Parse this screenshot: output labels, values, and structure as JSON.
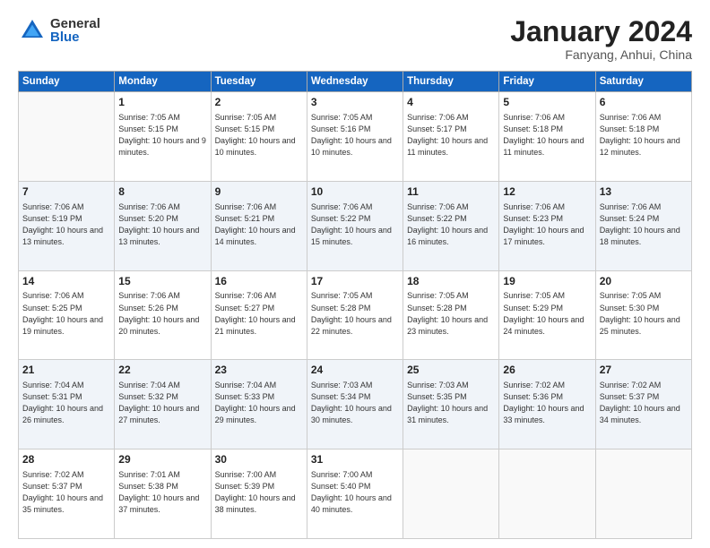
{
  "header": {
    "logo_general": "General",
    "logo_blue": "Blue",
    "month_title": "January 2024",
    "location": "Fanyang, Anhui, China"
  },
  "days_of_week": [
    "Sunday",
    "Monday",
    "Tuesday",
    "Wednesday",
    "Thursday",
    "Friday",
    "Saturday"
  ],
  "weeks": [
    {
      "days": [
        {
          "num": "",
          "info": ""
        },
        {
          "num": "1",
          "info": "Sunrise: 7:05 AM\nSunset: 5:15 PM\nDaylight: 10 hours\nand 9 minutes."
        },
        {
          "num": "2",
          "info": "Sunrise: 7:05 AM\nSunset: 5:15 PM\nDaylight: 10 hours\nand 10 minutes."
        },
        {
          "num": "3",
          "info": "Sunrise: 7:05 AM\nSunset: 5:16 PM\nDaylight: 10 hours\nand 10 minutes."
        },
        {
          "num": "4",
          "info": "Sunrise: 7:06 AM\nSunset: 5:17 PM\nDaylight: 10 hours\nand 11 minutes."
        },
        {
          "num": "5",
          "info": "Sunrise: 7:06 AM\nSunset: 5:18 PM\nDaylight: 10 hours\nand 11 minutes."
        },
        {
          "num": "6",
          "info": "Sunrise: 7:06 AM\nSunset: 5:18 PM\nDaylight: 10 hours\nand 12 minutes."
        }
      ]
    },
    {
      "days": [
        {
          "num": "7",
          "info": "Sunrise: 7:06 AM\nSunset: 5:19 PM\nDaylight: 10 hours\nand 13 minutes."
        },
        {
          "num": "8",
          "info": "Sunrise: 7:06 AM\nSunset: 5:20 PM\nDaylight: 10 hours\nand 13 minutes."
        },
        {
          "num": "9",
          "info": "Sunrise: 7:06 AM\nSunset: 5:21 PM\nDaylight: 10 hours\nand 14 minutes."
        },
        {
          "num": "10",
          "info": "Sunrise: 7:06 AM\nSunset: 5:22 PM\nDaylight: 10 hours\nand 15 minutes."
        },
        {
          "num": "11",
          "info": "Sunrise: 7:06 AM\nSunset: 5:22 PM\nDaylight: 10 hours\nand 16 minutes."
        },
        {
          "num": "12",
          "info": "Sunrise: 7:06 AM\nSunset: 5:23 PM\nDaylight: 10 hours\nand 17 minutes."
        },
        {
          "num": "13",
          "info": "Sunrise: 7:06 AM\nSunset: 5:24 PM\nDaylight: 10 hours\nand 18 minutes."
        }
      ]
    },
    {
      "days": [
        {
          "num": "14",
          "info": "Sunrise: 7:06 AM\nSunset: 5:25 PM\nDaylight: 10 hours\nand 19 minutes."
        },
        {
          "num": "15",
          "info": "Sunrise: 7:06 AM\nSunset: 5:26 PM\nDaylight: 10 hours\nand 20 minutes."
        },
        {
          "num": "16",
          "info": "Sunrise: 7:06 AM\nSunset: 5:27 PM\nDaylight: 10 hours\nand 21 minutes."
        },
        {
          "num": "17",
          "info": "Sunrise: 7:05 AM\nSunset: 5:28 PM\nDaylight: 10 hours\nand 22 minutes."
        },
        {
          "num": "18",
          "info": "Sunrise: 7:05 AM\nSunset: 5:28 PM\nDaylight: 10 hours\nand 23 minutes."
        },
        {
          "num": "19",
          "info": "Sunrise: 7:05 AM\nSunset: 5:29 PM\nDaylight: 10 hours\nand 24 minutes."
        },
        {
          "num": "20",
          "info": "Sunrise: 7:05 AM\nSunset: 5:30 PM\nDaylight: 10 hours\nand 25 minutes."
        }
      ]
    },
    {
      "days": [
        {
          "num": "21",
          "info": "Sunrise: 7:04 AM\nSunset: 5:31 PM\nDaylight: 10 hours\nand 26 minutes."
        },
        {
          "num": "22",
          "info": "Sunrise: 7:04 AM\nSunset: 5:32 PM\nDaylight: 10 hours\nand 27 minutes."
        },
        {
          "num": "23",
          "info": "Sunrise: 7:04 AM\nSunset: 5:33 PM\nDaylight: 10 hours\nand 29 minutes."
        },
        {
          "num": "24",
          "info": "Sunrise: 7:03 AM\nSunset: 5:34 PM\nDaylight: 10 hours\nand 30 minutes."
        },
        {
          "num": "25",
          "info": "Sunrise: 7:03 AM\nSunset: 5:35 PM\nDaylight: 10 hours\nand 31 minutes."
        },
        {
          "num": "26",
          "info": "Sunrise: 7:02 AM\nSunset: 5:36 PM\nDaylight: 10 hours\nand 33 minutes."
        },
        {
          "num": "27",
          "info": "Sunrise: 7:02 AM\nSunset: 5:37 PM\nDaylight: 10 hours\nand 34 minutes."
        }
      ]
    },
    {
      "days": [
        {
          "num": "28",
          "info": "Sunrise: 7:02 AM\nSunset: 5:37 PM\nDaylight: 10 hours\nand 35 minutes."
        },
        {
          "num": "29",
          "info": "Sunrise: 7:01 AM\nSunset: 5:38 PM\nDaylight: 10 hours\nand 37 minutes."
        },
        {
          "num": "30",
          "info": "Sunrise: 7:00 AM\nSunset: 5:39 PM\nDaylight: 10 hours\nand 38 minutes."
        },
        {
          "num": "31",
          "info": "Sunrise: 7:00 AM\nSunset: 5:40 PM\nDaylight: 10 hours\nand 40 minutes."
        },
        {
          "num": "",
          "info": ""
        },
        {
          "num": "",
          "info": ""
        },
        {
          "num": "",
          "info": ""
        }
      ]
    }
  ]
}
